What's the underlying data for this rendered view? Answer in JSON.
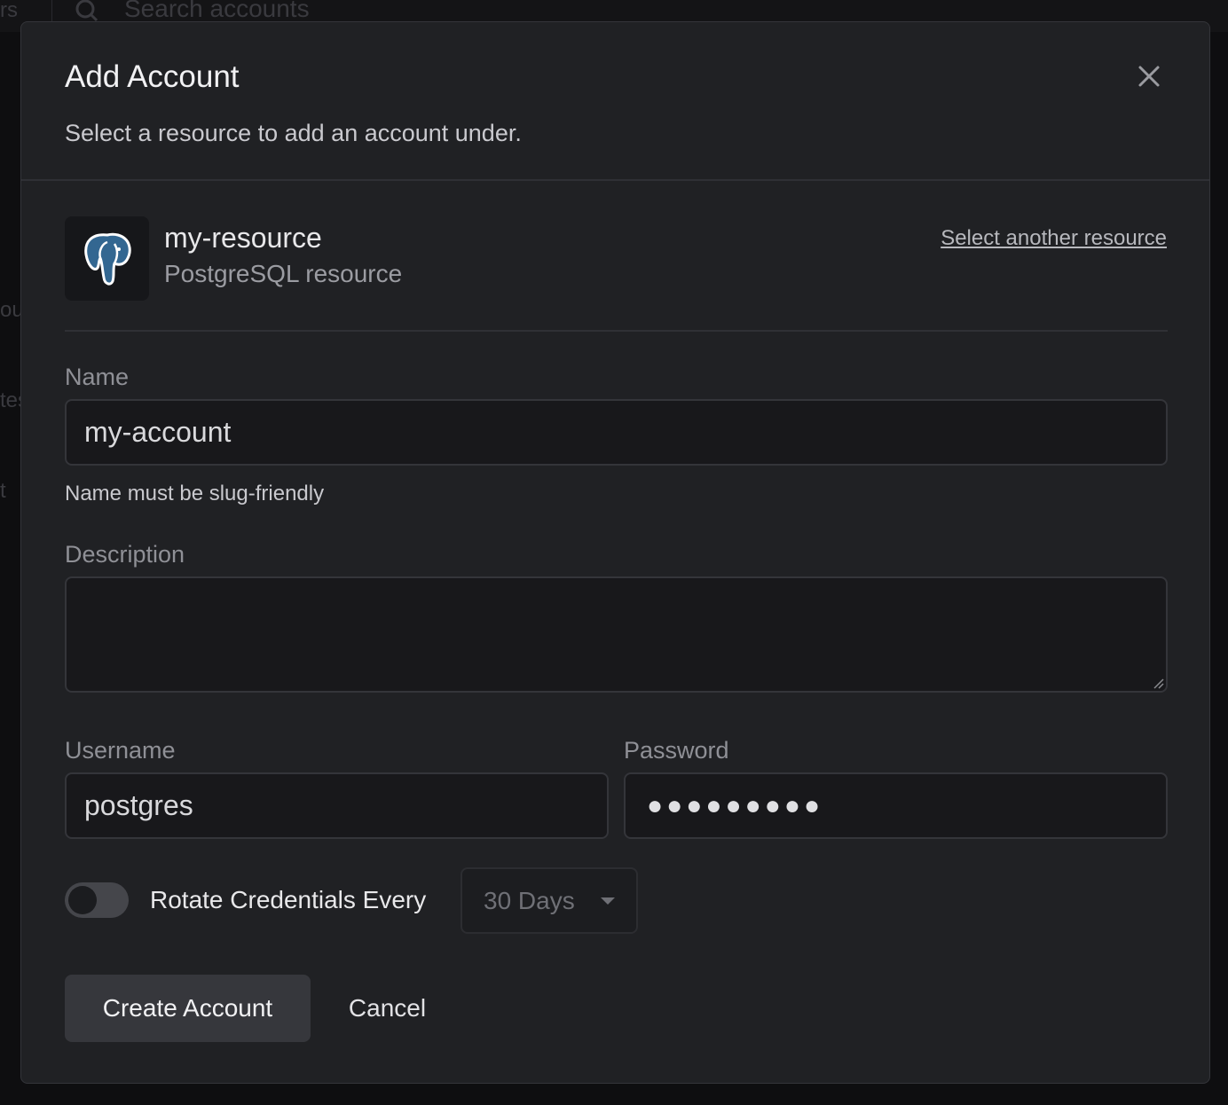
{
  "background": {
    "search_placeholder": "Search accounts",
    "left_fragments": [
      "rs",
      "ou",
      "tes",
      "t"
    ]
  },
  "modal": {
    "title": "Add Account",
    "subtitle": "Select a resource to add an account under."
  },
  "resource": {
    "name": "my-resource",
    "type": "PostgreSQL resource",
    "select_another_label": "Select another resource",
    "icon": "postgresql-elephant-icon"
  },
  "form": {
    "name_label": "Name",
    "name_value": "my-account",
    "name_helper": "Name must be slug-friendly",
    "description_label": "Description",
    "description_value": "",
    "username_label": "Username",
    "username_value": "postgres",
    "password_label": "Password",
    "password_masked": "●●●●●●●●●",
    "rotate_label": "Rotate Credentials Every",
    "rotate_enabled": false,
    "rotate_interval": "30 Days"
  },
  "actions": {
    "create_label": "Create Account",
    "cancel_label": "Cancel"
  },
  "colors": {
    "modal_bg": "#202124",
    "input_bg": "#18181b",
    "primary_button_bg": "#36373c",
    "postgres_blue": "#336791"
  }
}
